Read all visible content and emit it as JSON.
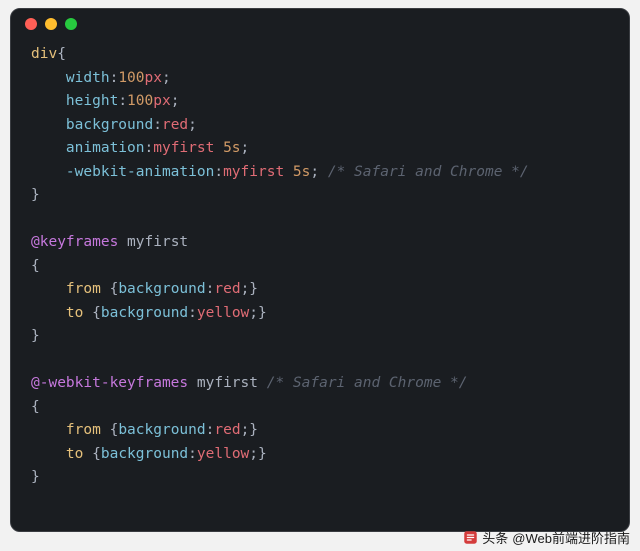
{
  "code": {
    "block1": {
      "selector": "div",
      "props": [
        {
          "name": "width",
          "num": "100",
          "unit": "px"
        },
        {
          "name": "height",
          "num": "100",
          "unit": "px"
        }
      ],
      "bg": {
        "name": "background",
        "value": "red"
      },
      "anim1": {
        "name": "animation",
        "ident": "myfirst",
        "dur": "5s"
      },
      "anim2": {
        "name": "-webkit-animation",
        "ident": "myfirst",
        "dur": "5s",
        "comment": "/* Safari and Chrome */"
      }
    },
    "kf1": {
      "rule": "@keyframes",
      "name": "myfirst",
      "from": {
        "key": "from",
        "prop": "background",
        "value": "red"
      },
      "to": {
        "key": "to",
        "prop": "background",
        "value": "yellow"
      }
    },
    "kf2": {
      "rule": "@-webkit-keyframes",
      "name": "myfirst",
      "comment": "/* Safari and Chrome */",
      "from": {
        "key": "from",
        "prop": "background",
        "value": "red"
      },
      "to": {
        "key": "to",
        "prop": "background",
        "value": "yellow"
      }
    }
  },
  "footer": {
    "prefix": "头条",
    "handle": "@Web前端进阶指南"
  }
}
